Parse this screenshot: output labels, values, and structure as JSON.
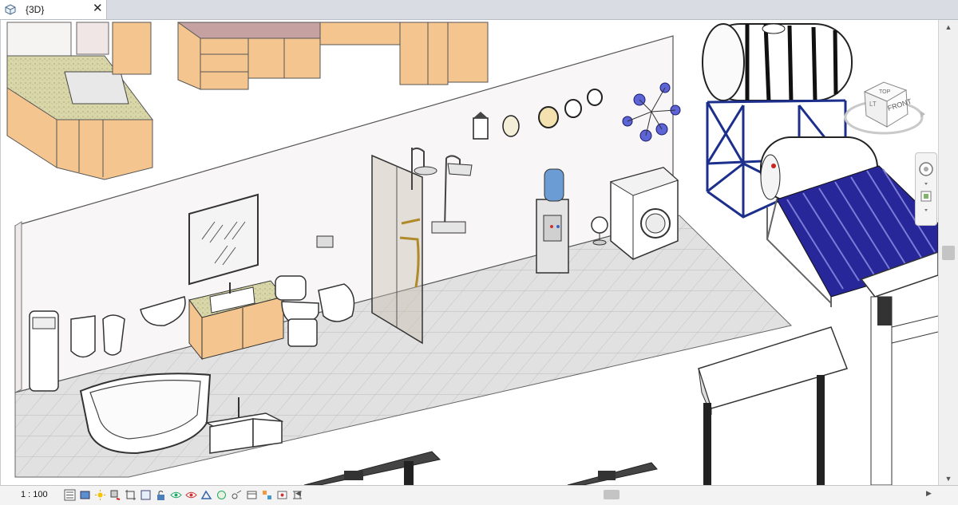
{
  "tab": {
    "label": "{3D}",
    "close": "✕",
    "icon": "3d-view-icon"
  },
  "viewcube": {
    "top": "TOP",
    "front": "FRONT",
    "left": "LT"
  },
  "status": {
    "scale": "1 : 100",
    "icons": [
      "detail-level-icon",
      "visual-style-icon",
      "sun-path-icon",
      "shadows-icon",
      "crop-view-icon",
      "show-crop-icon",
      "unlock-3d-icon",
      "temporary-hide-icon",
      "reveal-hidden-icon",
      "analytical-model-icon",
      "highlight-displacement-icon",
      "constraints-icon",
      "worksharing-icon",
      "design-options-icon",
      "select-links-icon",
      "select-pinned-icon"
    ]
  },
  "colors": {
    "cabinet": "#f5c58f",
    "floor": "#e1e1e1",
    "wall": "#f8f6f6",
    "solar_tubes": "#27279a",
    "frame": "#1c2f8c",
    "countertop": "#d9d6a8"
  }
}
